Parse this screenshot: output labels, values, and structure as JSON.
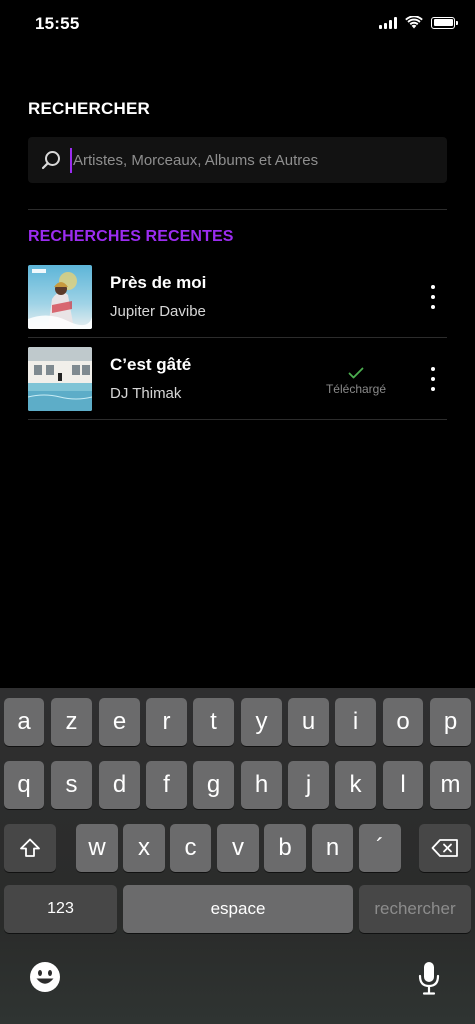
{
  "status_bar": {
    "time": "15:55"
  },
  "header": {
    "title": "RECHERCHER"
  },
  "search": {
    "placeholder": "Artistes, Morceaux, Albums et Autres",
    "value": ""
  },
  "recent": {
    "section_title": "RECHERCHES RECENTES",
    "items": [
      {
        "title": "Près de moi",
        "artist": "Jupiter Davibe"
      },
      {
        "title": "C’est gâté",
        "artist": "DJ Thimak",
        "status_label": "Téléchargé"
      }
    ]
  },
  "keyboard": {
    "row1": [
      "a",
      "z",
      "e",
      "r",
      "t",
      "y",
      "u",
      "i",
      "o",
      "p"
    ],
    "row2": [
      "q",
      "s",
      "d",
      "f",
      "g",
      "h",
      "j",
      "k",
      "l",
      "m"
    ],
    "row3": [
      "w",
      "x",
      "c",
      "v",
      "b",
      "n",
      "´"
    ],
    "numbers_label": "123",
    "space_label": "espace",
    "action_label": "rechercher"
  },
  "colors": {
    "accent": "#9b2cf0",
    "downloaded_check": "#4caf50",
    "background": "#000000"
  },
  "icons": {
    "search": "search-icon",
    "more": "more-vertical-icon",
    "check": "check-icon",
    "shift": "shift-icon",
    "backspace": "backspace-icon",
    "emoji": "emoji-icon",
    "mic": "microphone-icon"
  }
}
